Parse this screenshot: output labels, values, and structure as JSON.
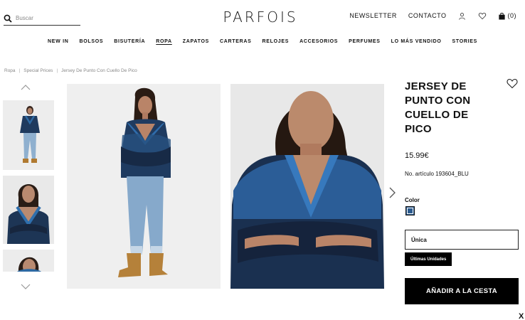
{
  "header": {
    "search_placeholder": "Buscar",
    "logo": "PARFOIS",
    "newsletter": "NEWSLETTER",
    "contact": "CONTACTO",
    "cart_count": "(0)"
  },
  "nav": [
    {
      "label": "NEW IN"
    },
    {
      "label": "BOLSOS"
    },
    {
      "label": "BISUTERÍA"
    },
    {
      "label": "ROPA",
      "active": true
    },
    {
      "label": "ZAPATOS"
    },
    {
      "label": "CARTERAS"
    },
    {
      "label": "RELOJES"
    },
    {
      "label": "ACCESORIOS"
    },
    {
      "label": "PERFUMES"
    },
    {
      "label": "LO MÁS VENDIDO"
    },
    {
      "label": "STORIES"
    }
  ],
  "breadcrumb": {
    "root": "Ropa",
    "middle": "Special Prices",
    "current": "Jersey De Punto Con Cuello De Pico",
    "separator": "|"
  },
  "product": {
    "title": "JERSEY DE PUNTO CON CUELLO DE PICO",
    "price": "15.99€",
    "article": "No. artículo 193604_BLU",
    "color_label": "Color",
    "color_hex": "#2a5a8e",
    "size": "Única",
    "stock_badge": "Últimas Unidades",
    "add_to_cart": "AÑADIR A LA CESTA"
  },
  "close_label": "X"
}
